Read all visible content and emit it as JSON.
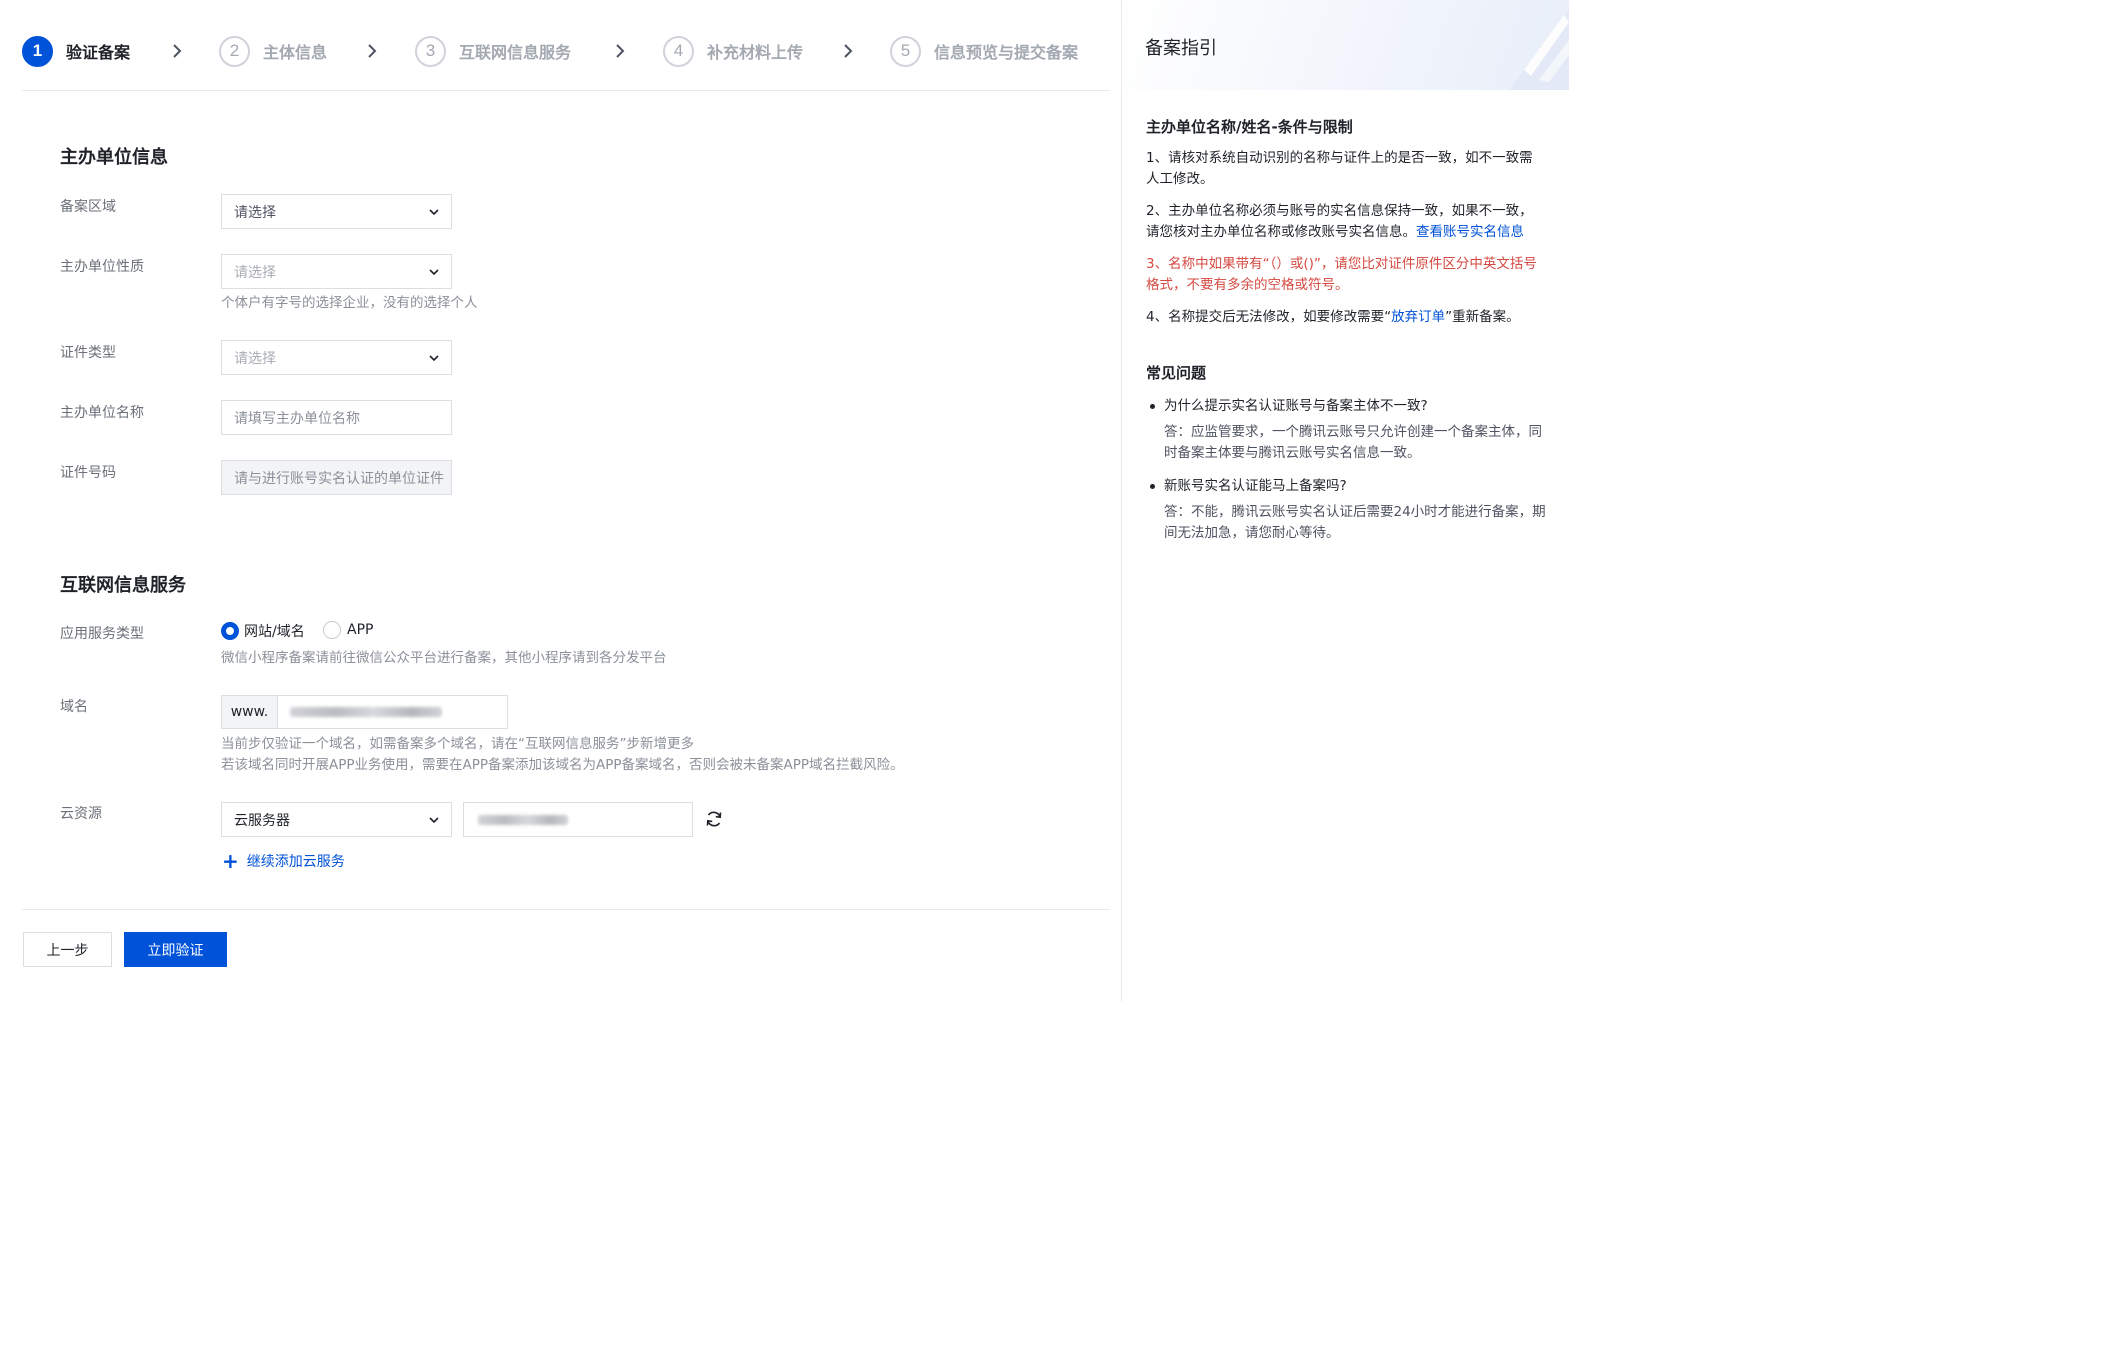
{
  "steps": [
    {
      "num": "1",
      "label": "验证备案",
      "active": true
    },
    {
      "num": "2",
      "label": "主体信息",
      "active": false
    },
    {
      "num": "3",
      "label": "互联网信息服务",
      "active": false
    },
    {
      "num": "4",
      "label": "补充材料上传",
      "active": false
    },
    {
      "num": "5",
      "label": "信息预览与提交备案",
      "active": false
    }
  ],
  "sponsor": {
    "title": "主办单位信息",
    "region_label": "备案区域",
    "region_value": "请选择",
    "nature_label": "主办单位性质",
    "nature_value": "请选择",
    "nature_hint": "个体户有字号的选择企业，没有的选择个人",
    "cert_type_label": "证件类型",
    "cert_type_value": "请选择",
    "name_label": "主办单位名称",
    "name_placeholder": "请填写主办单位名称",
    "cert_no_label": "证件号码",
    "cert_no_placeholder": "请与进行账号实名认证的单位证件"
  },
  "service": {
    "title": "互联网信息服务",
    "type_label": "应用服务类型",
    "radio_site": "网站/域名",
    "radio_app": "APP",
    "type_hint": "微信小程序备案请前往微信公众平台进行备案，其他小程序请到各分发平台",
    "domain_label": "域名",
    "domain_prefix": "www.",
    "domain_hint_1": "当前步仅验证一个域名，如需备案多个域名，请在“互联网信息服务”步新增更多",
    "domain_hint_2": "若该域名同时开展APP业务使用，需要在APP备案添加该域名为APP备案域名，否则会被未备案APP域名拦截风险。",
    "cloud_label": "云资源",
    "cloud_type": "云服务器",
    "add_cloud": "继续添加云服务"
  },
  "footer": {
    "prev": "上一步",
    "verify": "立即验证"
  },
  "guide": {
    "title": "备案指引",
    "section_title": "主办单位名称/姓名-条件与限制",
    "p1": "1、请核对系统自动识别的名称与证件上的是否一致，如不一致需人工修改。",
    "p2_text": "2、主办单位名称必须与账号的实名信息保持一致，如果不一致，请您核对主办单位名称或修改账号实名信息。",
    "p2_link": "查看账号实名信息",
    "p3": "3、名称中如果带有“（）或()”，请您比对证件原件区分中英文括号格式，不要有多余的空格或符号。",
    "p4_a": "4、名称提交后无法修改，如要修改需要“",
    "p4_link": "放弃订单",
    "p4_b": "”重新备案。",
    "faq_title": "常见问题",
    "faq": [
      {
        "q": "为什么提示实名认证账号与备案主体不一致?",
        "a": "答：应监管要求，一个腾讯云账号只允许创建一个备案主体，同时备案主体要与腾讯云账号实名信息一致。"
      },
      {
        "q": "新账号实名认证能马上备案吗?",
        "a": "答：不能，腾讯云账号实名认证后需要24小时才能进行备案，期间无法加急，请您耐心等待。"
      }
    ]
  },
  "colors": {
    "primary": "#0052d9",
    "warning": "#d54941"
  }
}
